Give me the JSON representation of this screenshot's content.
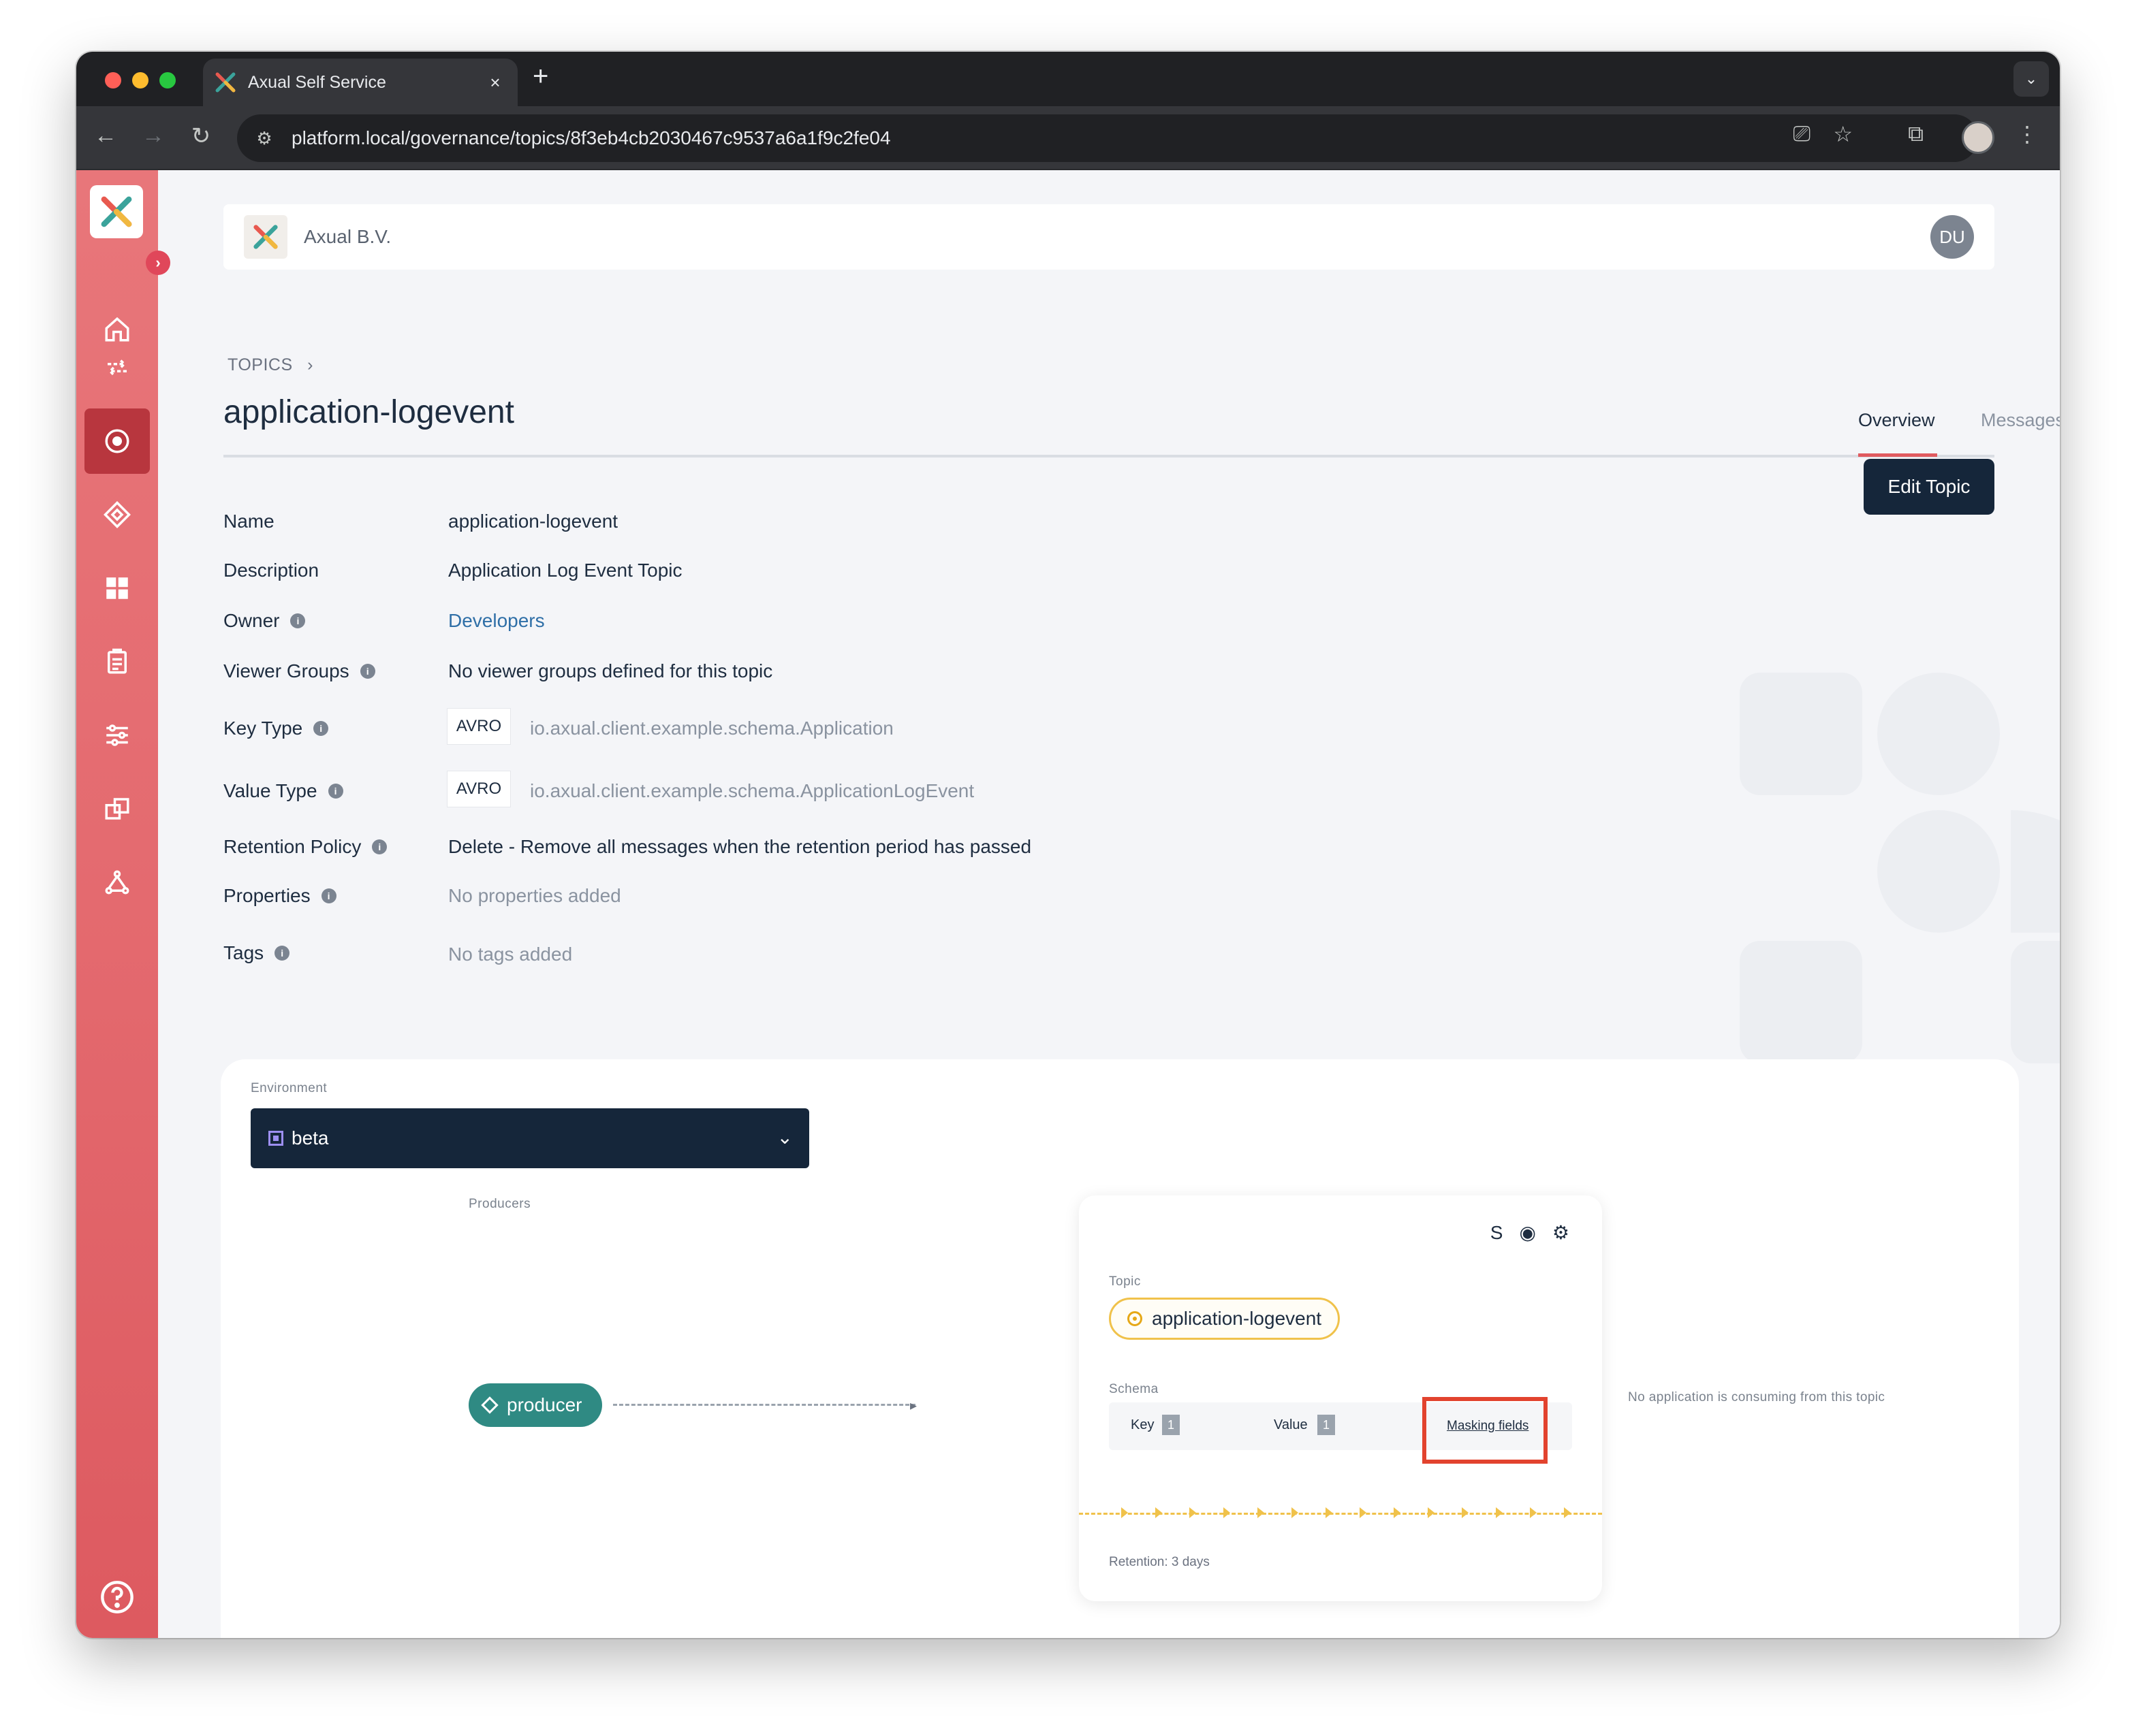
{
  "browser": {
    "tab_title": "Axual Self Service",
    "tab_close": "×",
    "new_tab": "+",
    "url": "platform.local/governance/topics/8f3eb4cb2030467c9537a6a1f9c2fe04"
  },
  "header": {
    "org_name": "Axual B.V.",
    "user_initials": "DU"
  },
  "sidebar": {
    "items": [
      {
        "name": "home",
        "active": false
      },
      {
        "name": "streams",
        "active": false
      },
      {
        "name": "topics",
        "active": true
      },
      {
        "name": "applications",
        "active": false
      },
      {
        "name": "dashboard",
        "active": false
      },
      {
        "name": "schemas",
        "active": false
      },
      {
        "name": "settings",
        "active": false
      },
      {
        "name": "environments",
        "active": false
      },
      {
        "name": "connectors",
        "active": false
      }
    ]
  },
  "breadcrumb": {
    "label": "TOPICS",
    "separator": "›"
  },
  "page": {
    "title": "application-logevent",
    "tabs": [
      {
        "label": "Overview",
        "active": true
      },
      {
        "label": "Messages",
        "active": false
      }
    ],
    "edit_button": "Edit Topic"
  },
  "fields": {
    "name": {
      "label": "Name",
      "value": "application-logevent"
    },
    "description": {
      "label": "Description",
      "value": "Application Log Event Topic"
    },
    "owner": {
      "label": "Owner",
      "value": "Developers"
    },
    "viewer_groups": {
      "label": "Viewer Groups",
      "value": "No viewer groups defined for this topic"
    },
    "key_type": {
      "label": "Key Type",
      "badge": "AVRO",
      "value": "io.axual.client.example.schema.Application"
    },
    "value_type": {
      "label": "Value Type",
      "badge": "AVRO",
      "value": "io.axual.client.example.schema.ApplicationLogEvent"
    },
    "retention_policy": {
      "label": "Retention Policy",
      "value": "Delete - Remove all messages when the retention period has passed"
    },
    "properties": {
      "label": "Properties",
      "value": "No properties added"
    },
    "tags": {
      "label": "Tags",
      "value": "No tags added"
    }
  },
  "environment": {
    "label": "Environment",
    "selected": "beta",
    "producers_label": "Producers",
    "producer_name": "producer",
    "consumers_empty": "No application is consuming from this topic"
  },
  "topic_card": {
    "topic_label": "Topic",
    "topic_name": "application-logevent",
    "schema_label": "Schema",
    "key_label": "Key",
    "key_count": "1",
    "value_label": "Value",
    "value_count": "1",
    "masking_link": "Masking fields",
    "retention": "Retention: 3 days",
    "icon_s": "S"
  },
  "colors": {
    "sidebar": "#e46a6f",
    "sidebar_active": "#b8363e",
    "primary_dark": "#15263a",
    "link": "#2f6fa7",
    "producer": "#2f8a83",
    "topic_border": "#f0c24b",
    "highlight": "#e2432e"
  }
}
